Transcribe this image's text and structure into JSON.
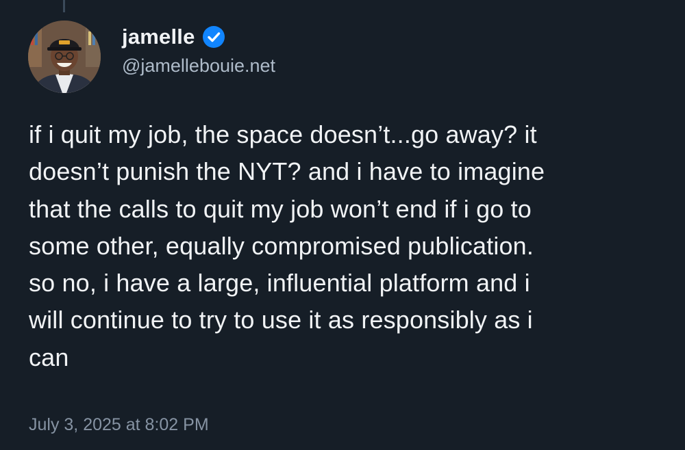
{
  "author": {
    "display_name": "jamelle",
    "handle": "@jamellebouie.net",
    "verified": true,
    "avatar_icon": "profile-photo"
  },
  "post": {
    "text_lines": [
      "if i quit my job, the space doesn’t...go away? it",
      "doesn’t punish the NYT? and i have to imagine",
      "that the calls to quit my job won’t end if i go to",
      "some other, equally compromised publication.",
      "so no, i have a large, influential platform and i",
      "will continue to try to use it as responsibly as i",
      "can"
    ],
    "timestamp": "July 3, 2025 at 8:02 PM"
  },
  "colors": {
    "background": "#161e27",
    "text_primary": "#f1f3f5",
    "text_secondary": "#aebbc9",
    "timestamp": "#8693a3",
    "verified_badge": "#1185fe"
  }
}
